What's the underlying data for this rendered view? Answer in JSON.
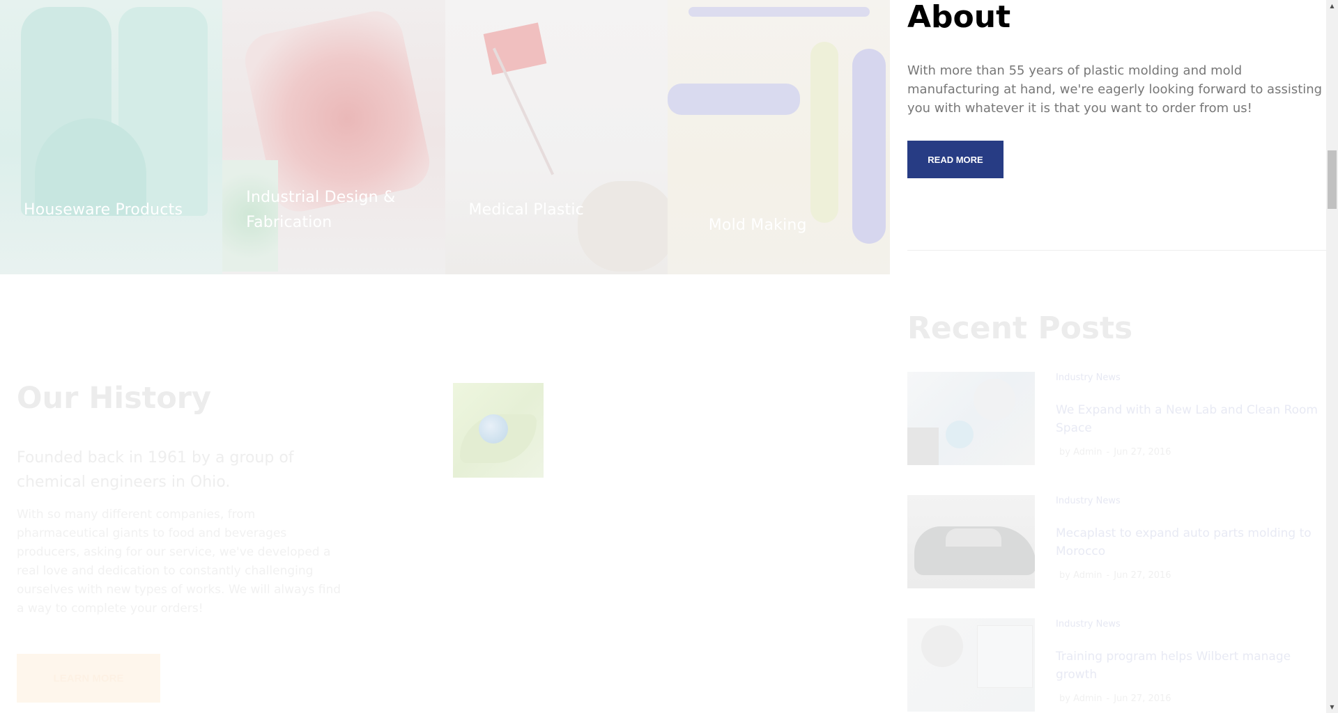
{
  "services": [
    {
      "label": "Houseware Products"
    },
    {
      "label": "Industrial Design & Fabrication"
    },
    {
      "label": "Medical Plastic"
    },
    {
      "label": "Mold Making"
    }
  ],
  "about": {
    "title": "About",
    "text": "With more than 55 years of plastic molding and mold manufacturing at hand, we're eagerly looking forward to assisting you with whatever it is that you want to order from us!",
    "button_label": "READ MORE"
  },
  "recent_posts": {
    "title": "Recent Posts",
    "meta_separator": "-",
    "posts": [
      {
        "category": "Industry News",
        "title": "We Expand with a New Lab and Clean Room Space",
        "author": "by Admin",
        "date": "Jun 27, 2016"
      },
      {
        "category": "Industry News",
        "title": "Mecaplast to expand auto parts molding to Morocco",
        "author": "by Admin",
        "date": "Jun 27, 2016"
      },
      {
        "category": "Industry News",
        "title": "Training program helps Wilbert manage growth",
        "author": "by Admin",
        "date": "Jun 27, 2016"
      }
    ]
  },
  "history": {
    "title": "Our History",
    "subtitle": "Founded back in 1961 by a group of chemical engineers in Ohio.",
    "text": "With so many different companies, from pharmaceutical giants to food and beverages producers, asking for our service, we've developed a real love and dedication to constantly challenging ourselves with new types of works. We will always find a way to complete your orders!",
    "button_label": "LEARN MORE"
  },
  "scrollbar": {
    "up_icon": "▲",
    "down_icon": "▼"
  },
  "colors": {
    "primary_button": "#273c84",
    "learn_more_button": "#fef6ec"
  }
}
